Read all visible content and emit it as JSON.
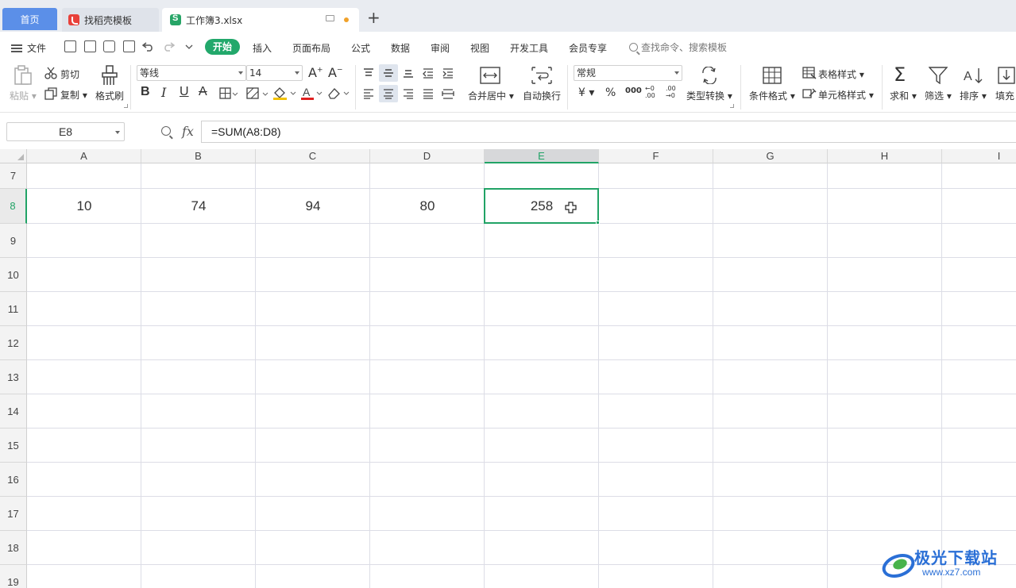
{
  "tabs": {
    "home": "首页",
    "template": "找稻壳模板",
    "active_file": "工作簿3.xlsx",
    "new_tab": "+"
  },
  "menu": {
    "file": "文件",
    "items": [
      "开始",
      "插入",
      "页面布局",
      "公式",
      "数据",
      "审阅",
      "视图",
      "开发工具",
      "会员专享"
    ],
    "search": "查找命令、搜索模板"
  },
  "ribbon": {
    "paste": "粘贴",
    "cut": "剪切",
    "copy": "复制",
    "format_painter": "格式刷",
    "font_name": "等线",
    "font_size": "14",
    "merge_center": "合并居中",
    "wrap_text": "自动换行",
    "number_format": "常规",
    "type_convert": "类型转换",
    "conditional_format": "条件格式",
    "table_style": "表格样式",
    "cell_style": "单元格样式",
    "sum": "求和",
    "filter": "筛选",
    "sort": "排序",
    "fill": "填充",
    "currency": "¥",
    "percent": "%",
    "thousands": "000",
    "inc_decimal": "←0 .00",
    "dec_decimal": ".00 →0"
  },
  "formula_bar": {
    "name_box": "E8",
    "fx": "fx",
    "formula": "=SUM(A8:D8)"
  },
  "grid": {
    "columns": [
      "A",
      "B",
      "C",
      "D",
      "E",
      "F",
      "G",
      "H",
      "I"
    ],
    "rows": [
      "7",
      "8",
      "9",
      "10",
      "11",
      "12",
      "13",
      "14",
      "15",
      "16",
      "17",
      "18",
      "19"
    ],
    "row8": [
      "10",
      "74",
      "94",
      "80",
      "258"
    ],
    "selected_cell": "E8"
  },
  "watermark": {
    "cn": "极光下载站",
    "en": "www.xz7.com"
  },
  "colors": {
    "accent_green": "#21a366",
    "home_tab_blue": "#5b8fe8",
    "start_pill": "#22a86b"
  }
}
